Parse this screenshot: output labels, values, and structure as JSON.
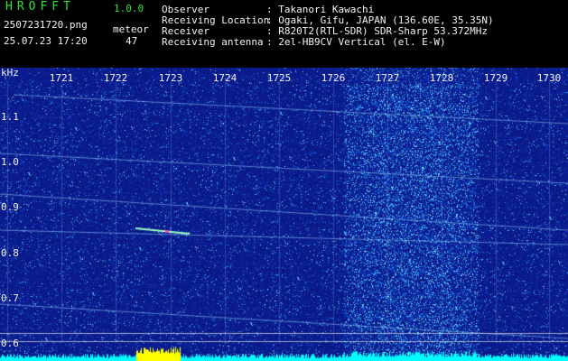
{
  "app": {
    "logo": "HROFFT",
    "version": "1.0.0",
    "filename": "2507231720.png",
    "datetime": "25.07.23 17:20",
    "counter_label": "meteor",
    "counter_value": "47"
  },
  "info": [
    {
      "key": "Observer",
      "value": ": Takanori Kawachi"
    },
    {
      "key": "Receiving Location",
      "value": ": Ogaki, Gifu, JAPAN (136.60E, 35.35N)"
    },
    {
      "key": "Receiver",
      "value": ": R820T2(RTL-SDR) SDR-Sharp 53.372MHz"
    },
    {
      "key": "Receiving antenna",
      "value": ": 2el-HB9CV Vertical (el. E-W)"
    }
  ],
  "axis": {
    "y_unit": "kHz",
    "x_ticks": [
      "1721",
      "1722",
      "1723",
      "1724",
      "1725",
      "1726",
      "1727",
      "1728",
      "1729",
      "1730"
    ],
    "y_ticks": [
      "1.1",
      "1.0",
      "0.9",
      "0.8",
      "0.7",
      "0.6"
    ]
  },
  "colors": {
    "background": "#000000",
    "waterfall_base": "#0a1a8a",
    "text": "#f2f2f2",
    "accent_green": "#35e03a",
    "signal_yellow": "#ffff00",
    "noise_cyan": "#00ffff"
  }
}
